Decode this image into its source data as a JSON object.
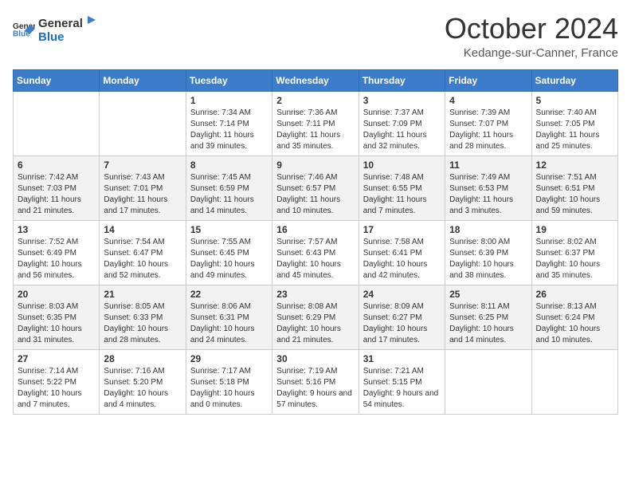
{
  "header": {
    "logo": {
      "general": "General",
      "blue": "Blue"
    },
    "title": "October 2024",
    "subtitle": "Kedange-sur-Canner, France"
  },
  "weekdays": [
    "Sunday",
    "Monday",
    "Tuesday",
    "Wednesday",
    "Thursday",
    "Friday",
    "Saturday"
  ],
  "weeks": [
    [
      {
        "day": "",
        "sunrise": "",
        "sunset": "",
        "daylight": ""
      },
      {
        "day": "",
        "sunrise": "",
        "sunset": "",
        "daylight": ""
      },
      {
        "day": "1",
        "sunrise": "Sunrise: 7:34 AM",
        "sunset": "Sunset: 7:14 PM",
        "daylight": "Daylight: 11 hours and 39 minutes."
      },
      {
        "day": "2",
        "sunrise": "Sunrise: 7:36 AM",
        "sunset": "Sunset: 7:11 PM",
        "daylight": "Daylight: 11 hours and 35 minutes."
      },
      {
        "day": "3",
        "sunrise": "Sunrise: 7:37 AM",
        "sunset": "Sunset: 7:09 PM",
        "daylight": "Daylight: 11 hours and 32 minutes."
      },
      {
        "day": "4",
        "sunrise": "Sunrise: 7:39 AM",
        "sunset": "Sunset: 7:07 PM",
        "daylight": "Daylight: 11 hours and 28 minutes."
      },
      {
        "day": "5",
        "sunrise": "Sunrise: 7:40 AM",
        "sunset": "Sunset: 7:05 PM",
        "daylight": "Daylight: 11 hours and 25 minutes."
      }
    ],
    [
      {
        "day": "6",
        "sunrise": "Sunrise: 7:42 AM",
        "sunset": "Sunset: 7:03 PM",
        "daylight": "Daylight: 11 hours and 21 minutes."
      },
      {
        "day": "7",
        "sunrise": "Sunrise: 7:43 AM",
        "sunset": "Sunset: 7:01 PM",
        "daylight": "Daylight: 11 hours and 17 minutes."
      },
      {
        "day": "8",
        "sunrise": "Sunrise: 7:45 AM",
        "sunset": "Sunset: 6:59 PM",
        "daylight": "Daylight: 11 hours and 14 minutes."
      },
      {
        "day": "9",
        "sunrise": "Sunrise: 7:46 AM",
        "sunset": "Sunset: 6:57 PM",
        "daylight": "Daylight: 11 hours and 10 minutes."
      },
      {
        "day": "10",
        "sunrise": "Sunrise: 7:48 AM",
        "sunset": "Sunset: 6:55 PM",
        "daylight": "Daylight: 11 hours and 7 minutes."
      },
      {
        "day": "11",
        "sunrise": "Sunrise: 7:49 AM",
        "sunset": "Sunset: 6:53 PM",
        "daylight": "Daylight: 11 hours and 3 minutes."
      },
      {
        "day": "12",
        "sunrise": "Sunrise: 7:51 AM",
        "sunset": "Sunset: 6:51 PM",
        "daylight": "Daylight: 10 hours and 59 minutes."
      }
    ],
    [
      {
        "day": "13",
        "sunrise": "Sunrise: 7:52 AM",
        "sunset": "Sunset: 6:49 PM",
        "daylight": "Daylight: 10 hours and 56 minutes."
      },
      {
        "day": "14",
        "sunrise": "Sunrise: 7:54 AM",
        "sunset": "Sunset: 6:47 PM",
        "daylight": "Daylight: 10 hours and 52 minutes."
      },
      {
        "day": "15",
        "sunrise": "Sunrise: 7:55 AM",
        "sunset": "Sunset: 6:45 PM",
        "daylight": "Daylight: 10 hours and 49 minutes."
      },
      {
        "day": "16",
        "sunrise": "Sunrise: 7:57 AM",
        "sunset": "Sunset: 6:43 PM",
        "daylight": "Daylight: 10 hours and 45 minutes."
      },
      {
        "day": "17",
        "sunrise": "Sunrise: 7:58 AM",
        "sunset": "Sunset: 6:41 PM",
        "daylight": "Daylight: 10 hours and 42 minutes."
      },
      {
        "day": "18",
        "sunrise": "Sunrise: 8:00 AM",
        "sunset": "Sunset: 6:39 PM",
        "daylight": "Daylight: 10 hours and 38 minutes."
      },
      {
        "day": "19",
        "sunrise": "Sunrise: 8:02 AM",
        "sunset": "Sunset: 6:37 PM",
        "daylight": "Daylight: 10 hours and 35 minutes."
      }
    ],
    [
      {
        "day": "20",
        "sunrise": "Sunrise: 8:03 AM",
        "sunset": "Sunset: 6:35 PM",
        "daylight": "Daylight: 10 hours and 31 minutes."
      },
      {
        "day": "21",
        "sunrise": "Sunrise: 8:05 AM",
        "sunset": "Sunset: 6:33 PM",
        "daylight": "Daylight: 10 hours and 28 minutes."
      },
      {
        "day": "22",
        "sunrise": "Sunrise: 8:06 AM",
        "sunset": "Sunset: 6:31 PM",
        "daylight": "Daylight: 10 hours and 24 minutes."
      },
      {
        "day": "23",
        "sunrise": "Sunrise: 8:08 AM",
        "sunset": "Sunset: 6:29 PM",
        "daylight": "Daylight: 10 hours and 21 minutes."
      },
      {
        "day": "24",
        "sunrise": "Sunrise: 8:09 AM",
        "sunset": "Sunset: 6:27 PM",
        "daylight": "Daylight: 10 hours and 17 minutes."
      },
      {
        "day": "25",
        "sunrise": "Sunrise: 8:11 AM",
        "sunset": "Sunset: 6:25 PM",
        "daylight": "Daylight: 10 hours and 14 minutes."
      },
      {
        "day": "26",
        "sunrise": "Sunrise: 8:13 AM",
        "sunset": "Sunset: 6:24 PM",
        "daylight": "Daylight: 10 hours and 10 minutes."
      }
    ],
    [
      {
        "day": "27",
        "sunrise": "Sunrise: 7:14 AM",
        "sunset": "Sunset: 5:22 PM",
        "daylight": "Daylight: 10 hours and 7 minutes."
      },
      {
        "day": "28",
        "sunrise": "Sunrise: 7:16 AM",
        "sunset": "Sunset: 5:20 PM",
        "daylight": "Daylight: 10 hours and 4 minutes."
      },
      {
        "day": "29",
        "sunrise": "Sunrise: 7:17 AM",
        "sunset": "Sunset: 5:18 PM",
        "daylight": "Daylight: 10 hours and 0 minutes."
      },
      {
        "day": "30",
        "sunrise": "Sunrise: 7:19 AM",
        "sunset": "Sunset: 5:16 PM",
        "daylight": "Daylight: 9 hours and 57 minutes."
      },
      {
        "day": "31",
        "sunrise": "Sunrise: 7:21 AM",
        "sunset": "Sunset: 5:15 PM",
        "daylight": "Daylight: 9 hours and 54 minutes."
      },
      {
        "day": "",
        "sunrise": "",
        "sunset": "",
        "daylight": ""
      },
      {
        "day": "",
        "sunrise": "",
        "sunset": "",
        "daylight": ""
      }
    ]
  ]
}
